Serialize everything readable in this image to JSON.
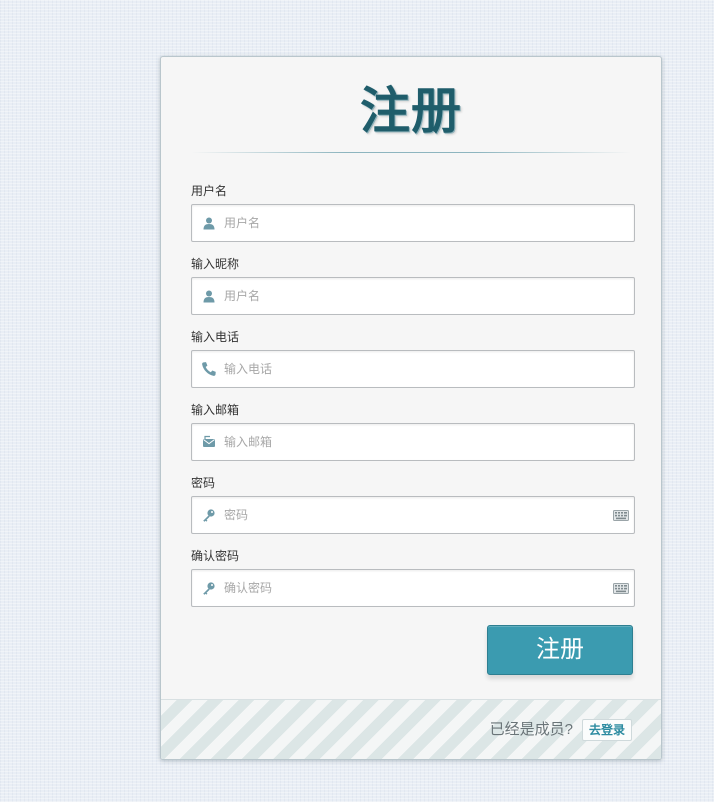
{
  "form": {
    "title": "注册",
    "fields": [
      {
        "label": "用户名",
        "placeholder": "用户名",
        "icon": "user-icon"
      },
      {
        "label": "输入昵称",
        "placeholder": "用户名",
        "icon": "user-icon"
      },
      {
        "label": "输入电话",
        "placeholder": "输入电话",
        "icon": "phone-icon"
      },
      {
        "label": "输入邮箱",
        "placeholder": "输入邮箱",
        "icon": "mail-icon"
      },
      {
        "label": "密码",
        "placeholder": "密码",
        "icon": "key-icon",
        "trailing_icon": "keyboard-icon"
      },
      {
        "label": "确认密码",
        "placeholder": "确认密码",
        "icon": "key-icon",
        "trailing_icon": "keyboard-icon"
      }
    ],
    "submit_label": "注册"
  },
  "footer": {
    "member_text": "已经是成员?",
    "login_label": "去登录"
  },
  "colors": {
    "accent": "#3b9bb0",
    "title": "#1f5d6b",
    "icon": "#6e9aa8"
  }
}
